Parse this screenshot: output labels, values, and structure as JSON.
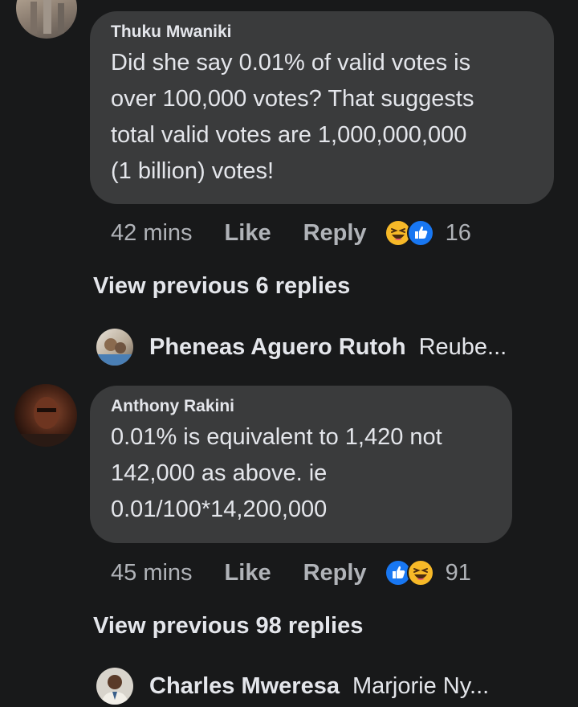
{
  "comments": [
    {
      "author": "Thuku Mwaniki",
      "lines": [
        "Did she say 0.01% of valid votes is",
        "over 100,000 votes? That suggests",
        "total valid votes are 1,000,000,000",
        "(1 billion) votes!"
      ],
      "time": "42 mins",
      "like_label": "Like",
      "reply_label": "Reply",
      "reactions": [
        "haha-icon",
        "like-icon"
      ],
      "reaction_count": "16",
      "view_previous": "View previous 6 replies",
      "latest_reply": {
        "name": "Pheneas Aguero Rutoh",
        "snippet": "Reube..."
      }
    },
    {
      "author": "Anthony Rakini",
      "lines": [
        "0.01% is equivalent to 1,420 not",
        "142,000 as above. ie",
        "0.01/100*14,200,000"
      ],
      "time": "45 mins",
      "like_label": "Like",
      "reply_label": "Reply",
      "reactions": [
        "like-icon",
        "haha-icon"
      ],
      "reaction_count": "91",
      "view_previous": "View previous 98 replies",
      "latest_reply": {
        "name": "Charles Mweresa",
        "snippet": "Marjorie Ny..."
      }
    }
  ],
  "colors": {
    "background": "#18191a",
    "bubble": "#3a3b3c",
    "primary_text": "#e4e6eb",
    "secondary_text": "#b0b3b8",
    "like_blue": "#1877f2",
    "haha_yellow": "#f7b928"
  }
}
